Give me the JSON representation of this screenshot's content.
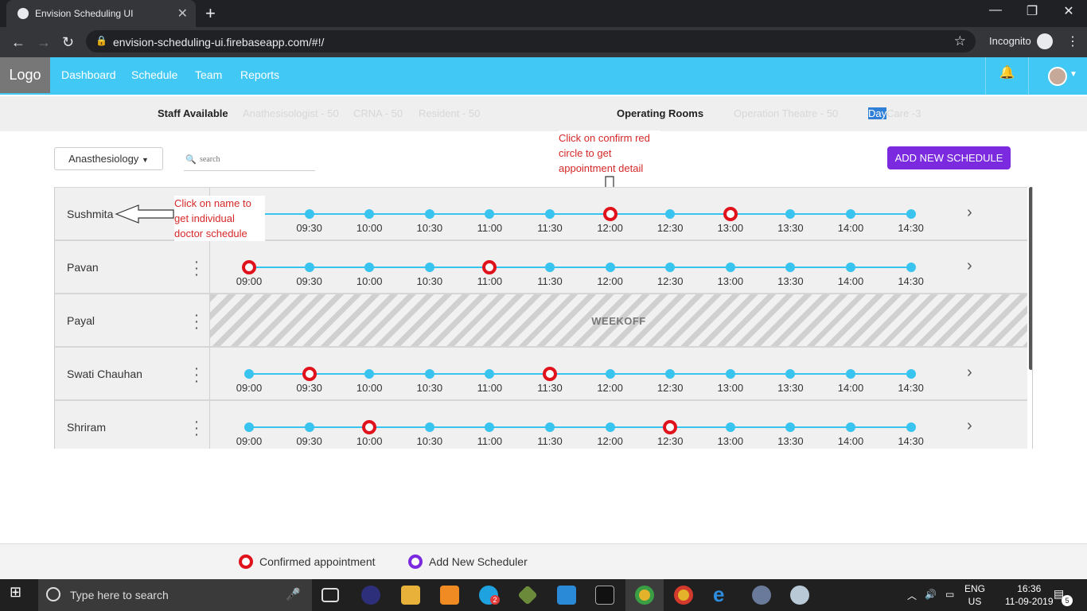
{
  "browser": {
    "tab_title": "Envision Scheduling UI",
    "url": "envision-scheduling-ui.firebaseapp.com/#!/",
    "incognito_label": "Incognito"
  },
  "nav": {
    "logo": "Logo",
    "links": [
      "Dashboard",
      "Schedule",
      "Team",
      "Reports"
    ]
  },
  "stats": {
    "staff_label": "Staff Available",
    "staff": [
      "Anathesisologist - 50",
      "CRNA - 50",
      "Resident - 50"
    ],
    "rooms_label": "Operating Rooms",
    "room_theatre": "Operation Theatre - 50",
    "day_sel": "Day",
    "day_rest": "Care -3"
  },
  "toolbar": {
    "dept_label": "Anasthesiology",
    "search_placeholder": "search",
    "add_button": "ADD NEW SCHEDULE"
  },
  "annotations": {
    "confirm_note": "Click on confirm red circle to get appointment detail",
    "name_note": "Click on name to get individual doctor schedule"
  },
  "times": [
    "09:00",
    "09:30",
    "10:00",
    "10:30",
    "11:00",
    "11:30",
    "12:00",
    "12:30",
    "13:00",
    "13:30",
    "14:00",
    "14:30"
  ],
  "rows": [
    {
      "name": "Sushmita",
      "confirmed": [
        "12:00",
        "13:00"
      ],
      "weekoff": false
    },
    {
      "name": "Pavan",
      "confirmed": [
        "09:00",
        "11:00"
      ],
      "weekoff": false
    },
    {
      "name": "Payal",
      "confirmed": [],
      "weekoff": true,
      "weekoff_label": "WEEKOFF"
    },
    {
      "name": "Swati Chauhan",
      "confirmed": [
        "09:30",
        "11:30"
      ],
      "weekoff": false
    },
    {
      "name": "Shriram",
      "confirmed": [
        "10:00",
        "12:30"
      ],
      "weekoff": false
    }
  ],
  "legend": {
    "confirmed": "Confirmed appointment",
    "add_new": "Add New Scheduler",
    "confirmed_color": "#e0121b",
    "add_color": "#7b2ae0"
  },
  "taskbar": {
    "search_placeholder": "Type here to search",
    "lang": "ENG",
    "region": "US",
    "time": "16:36",
    "date": "11-09-2019",
    "notif_count": "5",
    "skype_badge": "2"
  }
}
